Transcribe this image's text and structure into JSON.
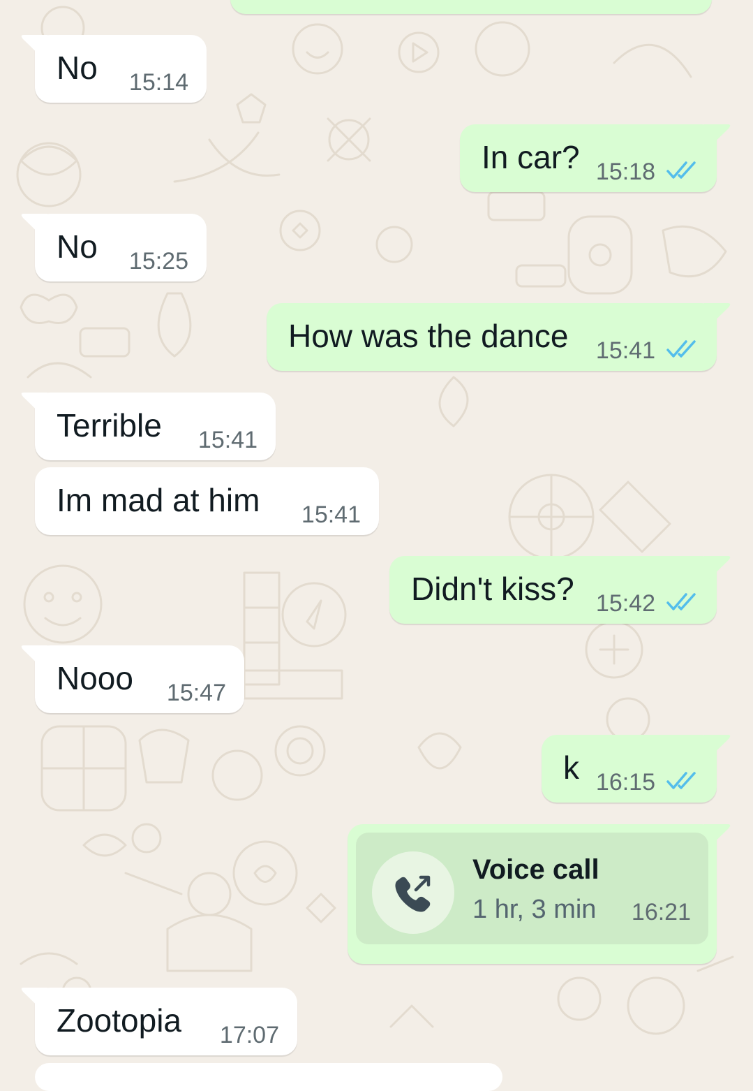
{
  "colors": {
    "background": "#f3eee7",
    "incoming_bubble": "#ffffff",
    "outgoing_bubble": "#d9fdd3",
    "read_ticks": "#53bdeb",
    "timestamp": "#5f6b71"
  },
  "messages": [
    {
      "direction": "in",
      "text": "No",
      "time": "15:14"
    },
    {
      "direction": "out",
      "text": "In car?",
      "time": "15:18",
      "status": "read"
    },
    {
      "direction": "in",
      "text": "No",
      "time": "15:25"
    },
    {
      "direction": "out",
      "text": "How was the dance",
      "time": "15:41",
      "status": "read"
    },
    {
      "direction": "in",
      "text": "Terrible",
      "time": "15:41"
    },
    {
      "direction": "in",
      "text": "Im mad at him",
      "time": "15:41"
    },
    {
      "direction": "out",
      "text": "Didn't kiss?",
      "time": "15:42",
      "status": "read"
    },
    {
      "direction": "in",
      "text": "Nooo",
      "time": "15:47"
    },
    {
      "direction": "out",
      "text": "k",
      "time": "16:15",
      "status": "read"
    },
    {
      "direction": "in",
      "text": "Zootopia",
      "time": "17:07"
    }
  ],
  "call": {
    "icon": "outgoing-call-icon",
    "title": "Voice call",
    "duration": "1 hr, 3 min",
    "time": "16:21"
  }
}
